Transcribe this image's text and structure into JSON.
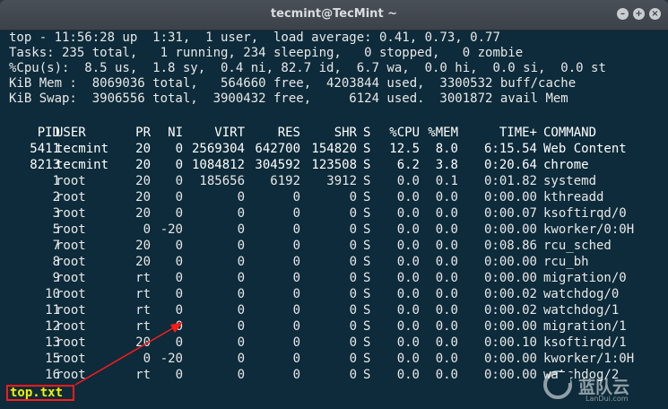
{
  "window": {
    "title": "tecmint@TecMint ~"
  },
  "summary": [
    "top - 11:56:28 up  1:31,  1 user,  load average: 0.41, 0.73, 0.77",
    "Tasks: 235 total,   1 running, 234 sleeping,   0 stopped,   0 zombie",
    "%Cpu(s):  8.5 us,  1.8 sy,  0.4 ni, 82.7 id,  6.7 wa,  0.0 hi,  0.0 si,  0.0 st",
    "KiB Mem :  8069036 total,   564660 free,  4203844 used,  3300532 buff/cache",
    "KiB Swap:  3906556 total,  3900432 free,     6124 used.  3001872 avail Mem"
  ],
  "table": {
    "columns": [
      "PID",
      "USER",
      "PR",
      "NI",
      "VIRT",
      "RES",
      "SHR",
      "S",
      "%CPU",
      "%MEM",
      "TIME+",
      "COMMAND"
    ],
    "rows": [
      [
        "5411",
        "tecmint",
        "20",
        "0",
        "2569304",
        "642700",
        "154820",
        "S",
        "12.5",
        "8.0",
        "6:15.54",
        "Web Content"
      ],
      [
        "8213",
        "tecmint",
        "20",
        "0",
        "1084812",
        "304592",
        "123508",
        "S",
        "6.2",
        "3.8",
        "0:20.64",
        "chrome"
      ],
      [
        "1",
        "root",
        "20",
        "0",
        "185656",
        "6192",
        "3912",
        "S",
        "0.0",
        "0.1",
        "0:01.82",
        "systemd"
      ],
      [
        "2",
        "root",
        "20",
        "0",
        "0",
        "0",
        "0",
        "S",
        "0.0",
        "0.0",
        "0:00.00",
        "kthreadd"
      ],
      [
        "3",
        "root",
        "20",
        "0",
        "0",
        "0",
        "0",
        "S",
        "0.0",
        "0.0",
        "0:00.07",
        "ksoftirqd/0"
      ],
      [
        "5",
        "root",
        "0",
        "-20",
        "0",
        "0",
        "0",
        "S",
        "0.0",
        "0.0",
        "0:00.00",
        "kworker/0:0H"
      ],
      [
        "7",
        "root",
        "20",
        "0",
        "0",
        "0",
        "0",
        "S",
        "0.0",
        "0.0",
        "0:08.86",
        "rcu_sched"
      ],
      [
        "8",
        "root",
        "20",
        "0",
        "0",
        "0",
        "0",
        "S",
        "0.0",
        "0.0",
        "0:00.00",
        "rcu_bh"
      ],
      [
        "9",
        "root",
        "rt",
        "0",
        "0",
        "0",
        "0",
        "S",
        "0.0",
        "0.0",
        "0:00.00",
        "migration/0"
      ],
      [
        "10",
        "root",
        "rt",
        "0",
        "0",
        "0",
        "0",
        "S",
        "0.0",
        "0.0",
        "0:00.02",
        "watchdog/0"
      ],
      [
        "11",
        "root",
        "rt",
        "0",
        "0",
        "0",
        "0",
        "S",
        "0.0",
        "0.0",
        "0:00.02",
        "watchdog/1"
      ],
      [
        "12",
        "root",
        "rt",
        "0",
        "0",
        "0",
        "0",
        "S",
        "0.0",
        "0.0",
        "0:00.00",
        "migration/1"
      ],
      [
        "13",
        "root",
        "20",
        "0",
        "0",
        "0",
        "0",
        "S",
        "0.0",
        "0.0",
        "0:00.10",
        "ksoftirqd/1"
      ],
      [
        "15",
        "root",
        "0",
        "-20",
        "0",
        "0",
        "0",
        "S",
        "0.0",
        "0.0",
        "0:00.00",
        "kworker/1:0H"
      ],
      [
        "16",
        "root",
        "rt",
        "0",
        "0",
        "0",
        "0",
        "S",
        "0.0",
        "0.0",
        "0:00.00",
        "watchdog/2"
      ]
    ]
  },
  "command_line": {
    "text": "top.txt"
  },
  "watermark": {
    "text": "蓝队云",
    "sub": "LanDui.com"
  },
  "colors": {
    "terminal_bg": "#0d2b3a",
    "text": "#e8e8e8",
    "highlight_text": "#f2f200",
    "annotation": "#ff1a1a"
  },
  "icons": [
    "minimize-icon",
    "maximize-icon",
    "close-icon",
    "annotation-arrow-icon",
    "watermark-logo-icon"
  ]
}
